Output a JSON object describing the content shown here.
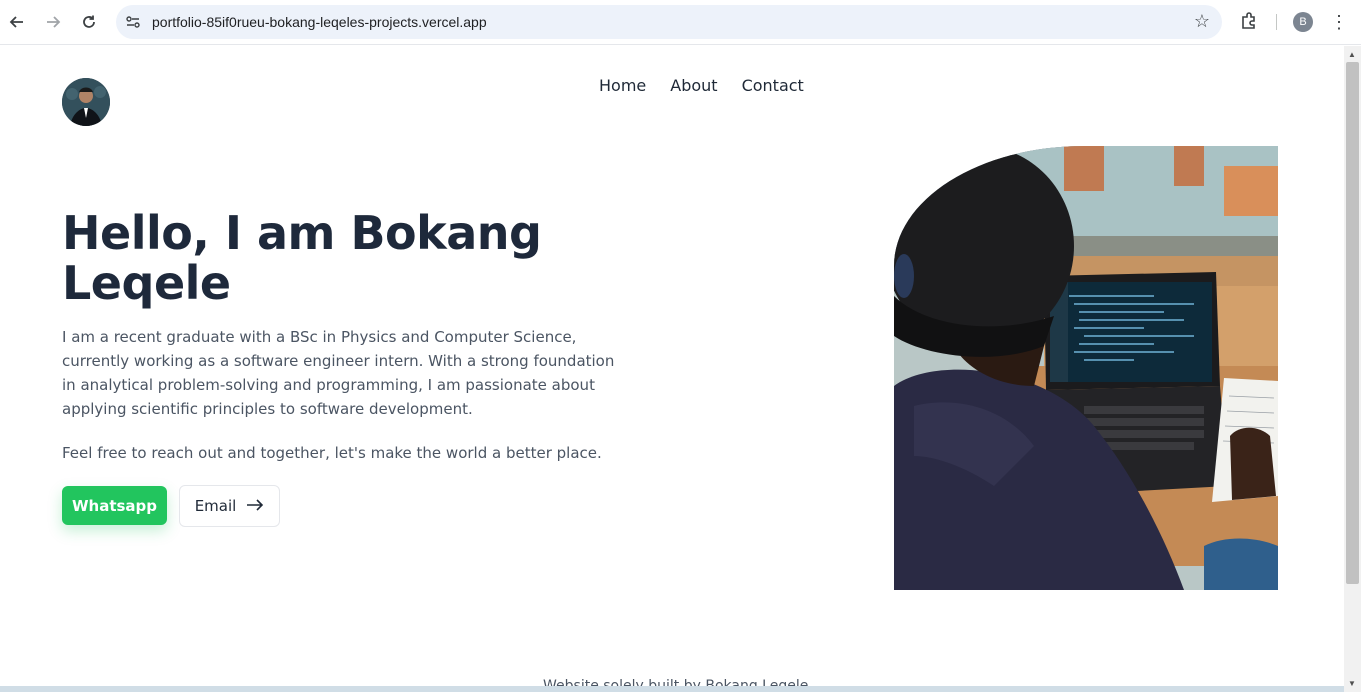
{
  "browser": {
    "url": "portfolio-85if0rueu-bokang-leqeles-projects.vercel.app",
    "profile_initial": "B",
    "icons": [
      "back-arrow-icon",
      "forward-arrow-icon",
      "reload-icon",
      "site-settings-icon",
      "star-icon",
      "extensions-icon",
      "kebab-menu-icon"
    ]
  },
  "nav": {
    "items": [
      {
        "label": "Home"
      },
      {
        "label": "About"
      },
      {
        "label": "Contact"
      }
    ]
  },
  "hero": {
    "title": "Hello, I am Bokang Leqele",
    "paragraph": "I am a recent graduate with a BSc in Physics and Computer Science, currently working as a software engineer intern. With a strong foundation in analytical problem-solving and programming, I am passionate about applying scientific principles to software development.",
    "paragraph2": "Feel free to reach out and together, let's make the world a better place.",
    "whatsapp_label": "Whatsapp",
    "email_label": "Email"
  },
  "footer": {
    "text": "Website solely built by Bokang Leqele"
  },
  "colors": {
    "accent_green": "#22c55e",
    "heading": "#1e293b",
    "body_text": "#4b5563"
  }
}
